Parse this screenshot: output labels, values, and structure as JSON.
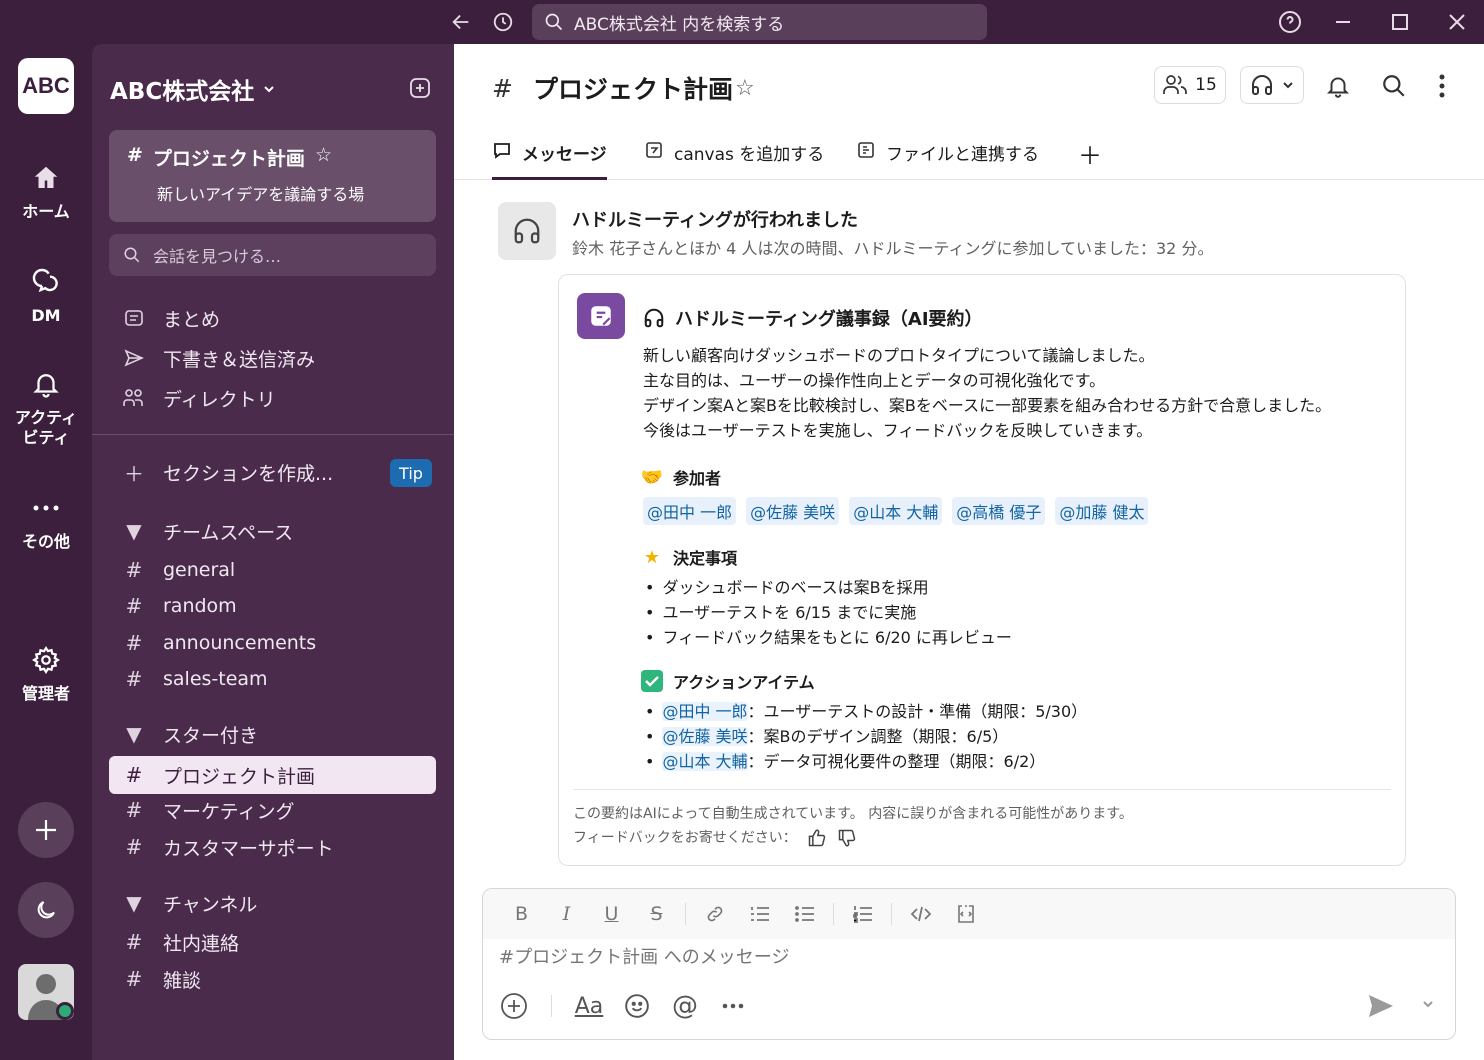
{
  "search": {
    "placeholder": "ABC株式会社 内を検索する"
  },
  "rail": {
    "workspace_logo": "ABC",
    "items": [
      {
        "label": "ホーム",
        "icon": "home-icon"
      },
      {
        "label": "DM",
        "icon": "dm-icon"
      },
      {
        "label": "アクティビティ",
        "icon": "bell-icon"
      },
      {
        "label": "その他",
        "icon": "more-icon"
      },
      {
        "label": "管理者",
        "icon": "gear-icon"
      }
    ]
  },
  "sidebar": {
    "workspace_name": "ABC株式会社",
    "channel_card": {
      "title": "プロジェクト計画",
      "desc": "新しいアイデアを議論する場"
    },
    "find_placeholder": "会話を見つける…",
    "nav": [
      "まとめ",
      "下書き＆送信済み",
      "ディレクトリ"
    ],
    "create_section": "セクションを作成...",
    "tip": "Tip",
    "sections": [
      {
        "name": "チームスペース",
        "channels": [
          "general",
          "random",
          "announcements",
          "sales-team"
        ]
      },
      {
        "name": "スター付き",
        "channels": [
          "プロジェクト計画",
          "マーケティング",
          "カスタマーサポート"
        ]
      },
      {
        "name": "チャンネル",
        "channels": [
          "社内連絡",
          "雑談"
        ]
      }
    ]
  },
  "header": {
    "channel_name": "プロジェクト計画",
    "member_count": "15"
  },
  "tabs": [
    "メッセージ",
    "canvas を追加する",
    "ファイルと連携する"
  ],
  "huddle": {
    "title": "ハドルミーティングが行われました",
    "subtitle": "鈴木 花子さんとほか 4 人は次の時間、ハドルミーティングに参加していました：32 分。"
  },
  "summary_card": {
    "title": "ハドルミーティング議事録（AI要約）",
    "lines": [
      "新しい顧客向けダッシュボードのプロトタイプについて議論しました。",
      "主な目的は、ユーザーの操作性向上とデータの可視化強化です。",
      "デザイン案Aと案Bを比較検討し、案Bをベースに一部要素を組み合わせる方針で合意しました。",
      "今後はユーザーテストを実施し、フィードバックを反映していきます。"
    ],
    "participants_heading": "参加者",
    "participants": [
      "@田中 一郎",
      "@佐藤 美咲",
      "@山本 大輔",
      "@高橋 優子",
      "@加藤 健太"
    ],
    "decisions_heading": "決定事項",
    "decisions": [
      "ダッシュボードのベースは案Bを採用",
      "ユーザーテストを 6/15 までに実施",
      "フィードバック結果をもとに 6/20 に再レビュー"
    ],
    "actions_heading": "アクションアイテム",
    "actions": [
      {
        "who": "@田中 一郎",
        "what": "：ユーザーテストの設計・準備（期限：5/30）"
      },
      {
        "who": "@佐藤 美咲",
        "what": "：案Bのデザイン調整（期限：6/5）"
      },
      {
        "who": "@山本 大輔",
        "what": "：データ可視化要件の整理（期限：6/2）"
      }
    ],
    "footer_note": "この要約はAIによって自動生成されています。 内容に誤りが含まれる可能性があります。",
    "footer_feedback": "フィードバックをお寄せください："
  },
  "composer": {
    "placeholder": "#プロジェクト計画 へのメッセージ"
  },
  "colors": {
    "aubergine": "#3b1f3c",
    "sidebar": "#4a2b4b",
    "link": "#1264a3",
    "app_icon": "#7a4aa0"
  }
}
